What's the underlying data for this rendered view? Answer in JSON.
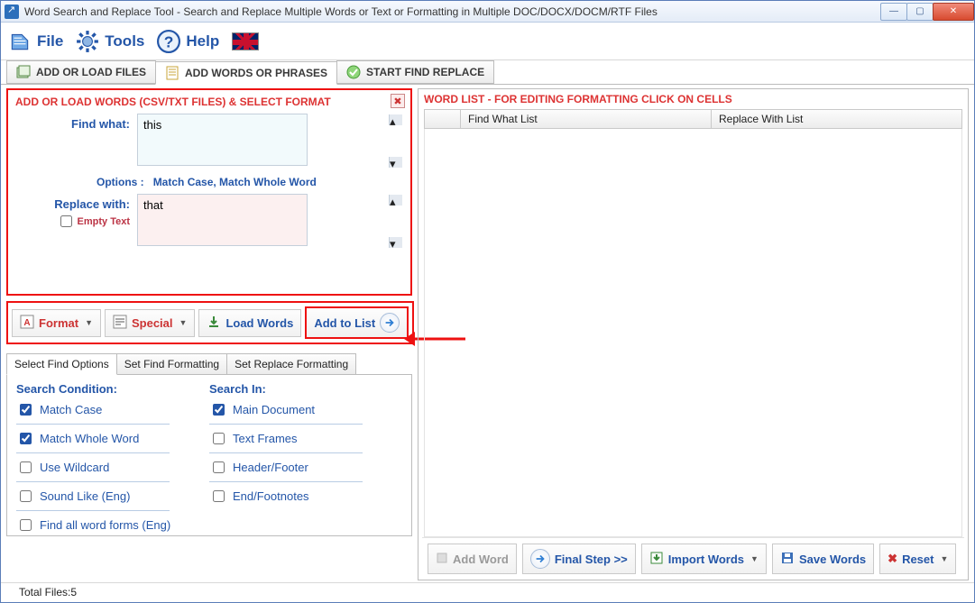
{
  "window": {
    "title": "Word Search and Replace Tool - Search and Replace Multiple Words or Text  or Formatting in Multiple DOC/DOCX/DOCM/RTF Files"
  },
  "menu": {
    "file": "File",
    "tools": "Tools",
    "help": "Help"
  },
  "tabs": {
    "add_files": "ADD OR LOAD FILES",
    "add_words": "ADD WORDS OR PHRASES",
    "start": "START FIND REPLACE"
  },
  "left_panel": {
    "title": "ADD OR LOAD WORDS (CSV/TXT FILES) & SELECT FORMAT",
    "find_label": "Find what:",
    "find_value": "this",
    "options_label": "Options :",
    "options_value": "Match Case, Match Whole Word",
    "replace_label": "Replace with:",
    "empty_text_label": "Empty Text",
    "replace_value": "that"
  },
  "toolbar": {
    "format": "Format",
    "special": "Special",
    "load_words": "Load Words",
    "add_to_list": "Add to List"
  },
  "subtabs": {
    "select_find": "Select Find Options",
    "set_find_fmt": "Set Find Formatting",
    "set_replace_fmt": "Set Replace Formatting"
  },
  "search_condition": {
    "heading": "Search Condition:",
    "match_case": "Match Case",
    "match_whole": "Match Whole Word",
    "wildcard": "Use Wildcard",
    "sound_like": "Sound Like (Eng)",
    "word_forms": "Find all word forms (Eng)"
  },
  "search_in": {
    "heading": "Search In:",
    "main_doc": "Main Document",
    "text_frames": "Text Frames",
    "header_footer": "Header/Footer",
    "end_footnotes": "End/Footnotes"
  },
  "right_panel": {
    "title": "WORD LIST - FOR EDITING FORMATTING CLICK ON CELLS",
    "col_blank": "",
    "col_find": "Find What List",
    "col_replace": "Replace With List"
  },
  "bottom": {
    "add_word": "Add Word",
    "final_step": "Final Step >>",
    "import_words": "Import Words",
    "save_words": "Save Words",
    "reset": "Reset"
  },
  "status": {
    "total_files": "Total Files:5"
  }
}
